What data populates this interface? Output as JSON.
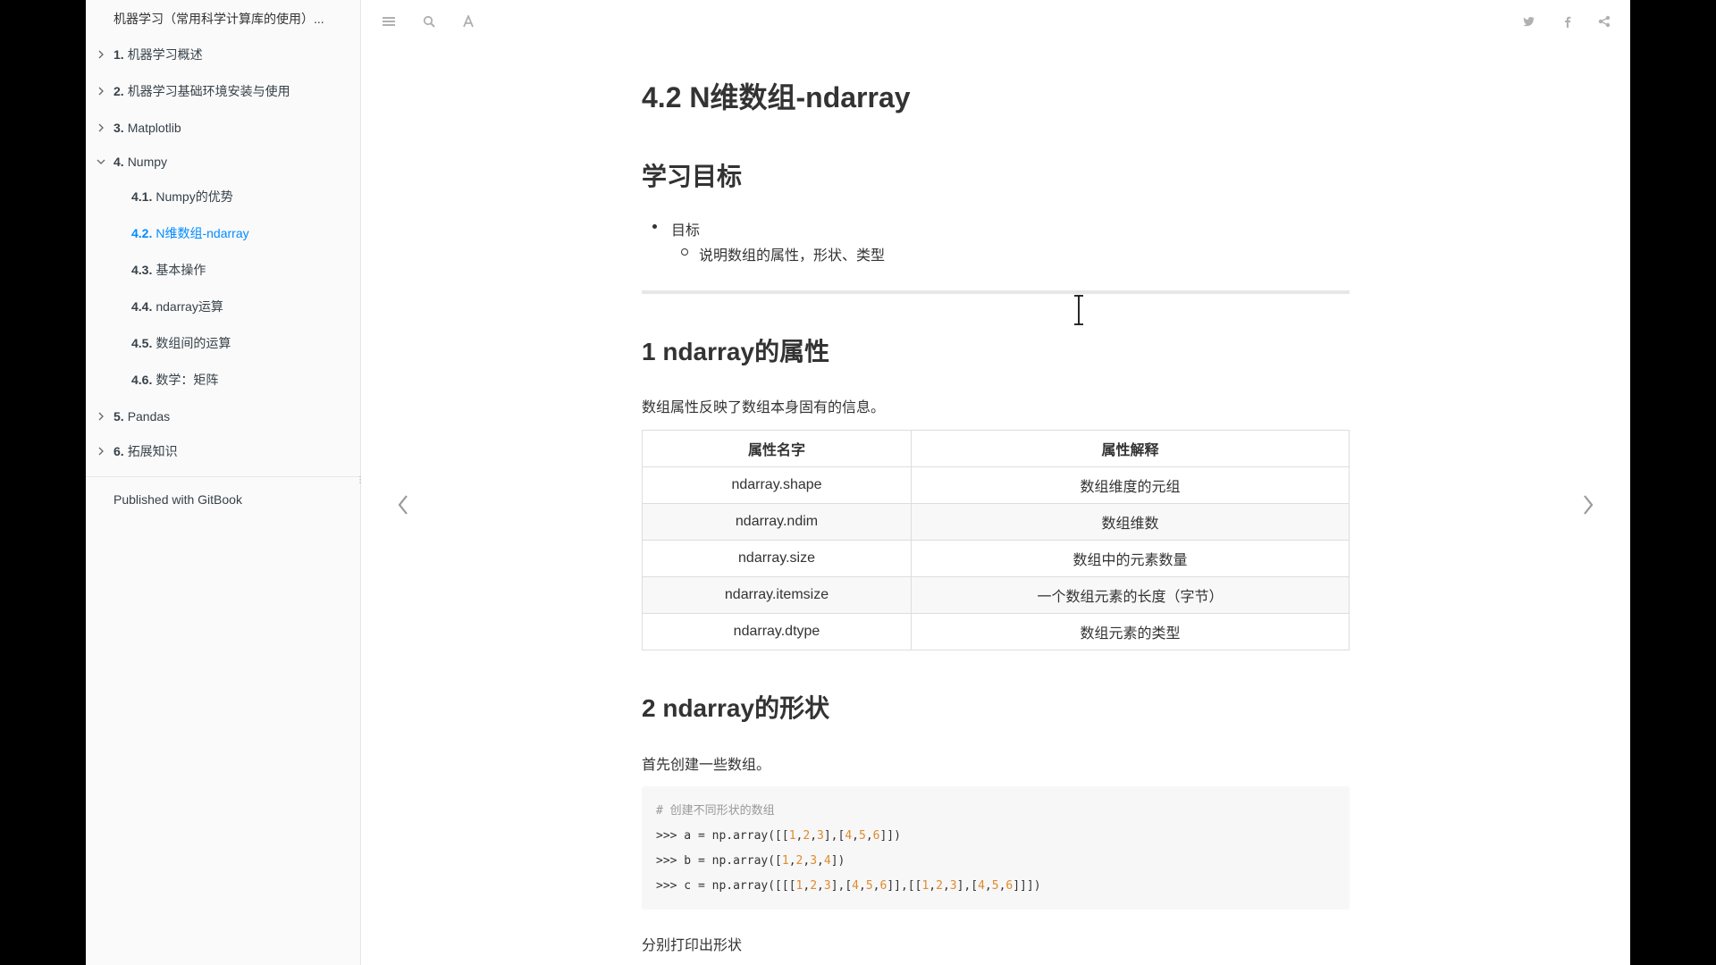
{
  "sidebar": {
    "book_title": "机器学习（常用科学计算库的使用）...",
    "items": [
      {
        "num": "1.",
        "label": "机器学习概述",
        "chevron": "chevron-right"
      },
      {
        "num": "2.",
        "label": "机器学习基础环境安装与使用",
        "chevron": "chevron-right"
      },
      {
        "num": "3.",
        "label": "Matplotlib",
        "chevron": "chevron-right"
      },
      {
        "num": "4.",
        "label": "Numpy",
        "chevron": "chevron-down"
      },
      {
        "num": "4.1.",
        "label": "Numpy的优势"
      },
      {
        "num": "4.2.",
        "label": "N维数组-ndarray",
        "active": true
      },
      {
        "num": "4.3.",
        "label": "基本操作"
      },
      {
        "num": "4.4.",
        "label": "ndarray运算"
      },
      {
        "num": "4.5.",
        "label": "数组间的运算"
      },
      {
        "num": "4.6.",
        "label": "数学：矩阵"
      },
      {
        "num": "5.",
        "label": "Pandas",
        "chevron": "chevron-right"
      },
      {
        "num": "6.",
        "label": "拓展知识",
        "chevron": "chevron-right"
      }
    ],
    "footer": "Published with GitBook"
  },
  "header": {
    "icons": [
      "menu-icon",
      "search-icon",
      "font-settings-icon",
      "twitter-icon",
      "facebook-icon",
      "share-icon"
    ]
  },
  "content": {
    "title": "4.2 N维数组-ndarray",
    "goal_heading": "学习目标",
    "goal_bullet": "目标",
    "goal_sub_bullet": "说明数组的属性，形状、类型",
    "section1_heading": "1 ndarray的属性",
    "section1_desc": "数组属性反映了数组本身固有的信息。",
    "table": {
      "headers": [
        "属性名字",
        "属性解释"
      ],
      "rows": [
        [
          "ndarray.shape",
          "数组维度的元组"
        ],
        [
          "ndarray.ndim",
          "数组维数"
        ],
        [
          "ndarray.size",
          "数组中的元素数量"
        ],
        [
          "ndarray.itemsize",
          "一个数组元素的长度（字节）"
        ],
        [
          "ndarray.dtype",
          "数组元素的类型"
        ]
      ]
    },
    "section2_heading": "2 ndarray的形状",
    "section2_desc": "首先创建一些数组。",
    "code": {
      "comment": "# 创建不同形状的数组",
      "lines": [
        ">>> a = np.array([[1,2,3],[4,5,6]])",
        ">>> b = np.array([1,2,3,4])",
        ">>> c = np.array([[[1,2,3],[4,5,6]],[[1,2,3],[4,5,6]]])"
      ]
    },
    "section2_desc2": "分别打印出形状"
  },
  "colors": {
    "active_link": "#008cff",
    "code_number": "#e08a2e",
    "sidebar_bg": "#fafafa"
  }
}
